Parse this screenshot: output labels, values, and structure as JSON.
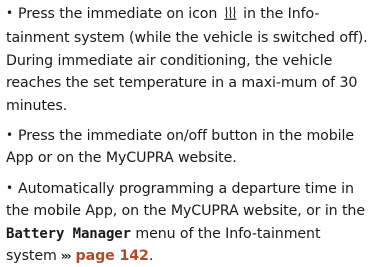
{
  "items": [
    {
      "bullet": "•",
      "before": "Press the immediate on icon",
      "icon": "heat-waves-icon",
      "after": "in the Info-tainment system (while the vehicle is switched off). During immediate air conditioning, the vehicle reaches the set temperature in a maxi-mum of 30 minutes."
    },
    {
      "bullet": "•",
      "text": "Press the immediate on/off button in the mobile App or on the MyCUPRA website."
    },
    {
      "bullet": "•",
      "before": "Automatically programming a departure time in the mobile App, on the MyCUPRA website, or in the",
      "menu": "Battery Manager",
      "middle": "menu of the Info-tainment system",
      "arrows": "›››",
      "ref": "page 142",
      "end": "."
    }
  ],
  "colors": {
    "text": "#1a1a1a",
    "link": "#b04a2a"
  }
}
